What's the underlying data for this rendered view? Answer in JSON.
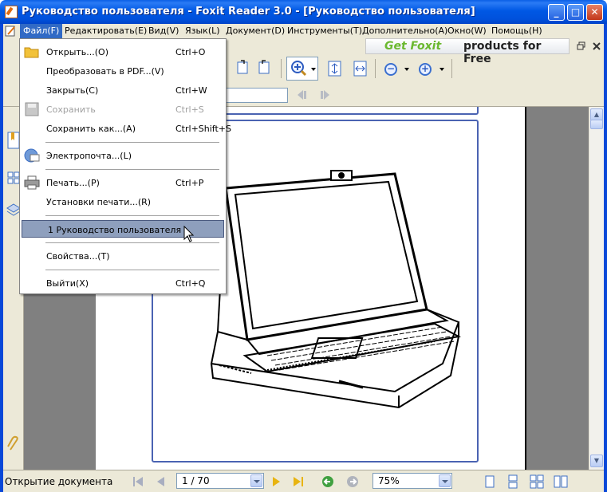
{
  "window": {
    "title": "Руководство пользователя - Foxit Reader 3.0 - [Руководство пользователя]",
    "minimize_label": "_",
    "maximize_label": "□",
    "close_label": "✕"
  },
  "menubar": {
    "items": [
      {
        "label": "Файл(F)"
      },
      {
        "label": "Редактировать(E)"
      },
      {
        "label": "Вид(V)"
      },
      {
        "label": "Язык(L)"
      },
      {
        "label": "Документ(D)"
      },
      {
        "label": "Инструменты(T)"
      },
      {
        "label": "Дополнительно(A)"
      },
      {
        "label": "Окно(W)"
      },
      {
        "label": "Помощь(H)"
      }
    ]
  },
  "ad": {
    "text_brand": "Get Foxit",
    "text_rest": "products for Free"
  },
  "file_menu": {
    "items": [
      {
        "label": "Открыть...(O)",
        "shortcut": "Ctrl+O",
        "icon": "folder-icon"
      },
      {
        "label": "Преобразовать в PDF...(V)",
        "shortcut": ""
      },
      {
        "label": "Закрыть(C)",
        "shortcut": "Ctrl+W"
      },
      {
        "label": "Сохранить",
        "shortcut": "Ctrl+S",
        "disabled": true,
        "icon": "save-icon"
      },
      {
        "label": "Сохранить как...(A)",
        "shortcut": "Ctrl+Shift+S"
      },
      {
        "label": "Электропочта...(L)",
        "shortcut": "",
        "icon": "email-icon"
      },
      {
        "label": "Печать...(P)",
        "shortcut": "Ctrl+P",
        "icon": "printer-icon"
      },
      {
        "label": "Установки печати...(R)",
        "shortcut": ""
      },
      {
        "label": "1 Руководство пользователя",
        "shortcut": "",
        "highlighted": true
      },
      {
        "label": "Свойства...(T)",
        "shortcut": ""
      },
      {
        "label": "Выйти(X)",
        "shortcut": "Ctrl+Q"
      }
    ]
  },
  "statusbar": {
    "status_text": "Открытие документа",
    "page_value": "1 / 70",
    "zoom_value": "75%"
  },
  "colors": {
    "titlebar": "#0058e4",
    "menu_highlight": "#8e9fbd",
    "page_frame": "#4a63b2",
    "ad_green": "#6ab82e"
  }
}
